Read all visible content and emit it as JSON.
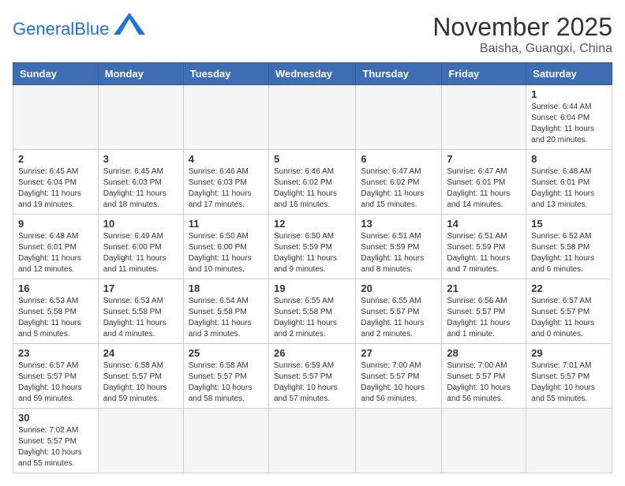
{
  "header": {
    "logo_general": "General",
    "logo_blue": "Blue",
    "month_title": "November 2025",
    "location": "Baisha, Guangxi, China"
  },
  "days_of_week": [
    "Sunday",
    "Monday",
    "Tuesday",
    "Wednesday",
    "Thursday",
    "Friday",
    "Saturday"
  ],
  "weeks": [
    [
      {
        "day": "",
        "info": ""
      },
      {
        "day": "",
        "info": ""
      },
      {
        "day": "",
        "info": ""
      },
      {
        "day": "",
        "info": ""
      },
      {
        "day": "",
        "info": ""
      },
      {
        "day": "",
        "info": ""
      },
      {
        "day": "1",
        "info": "Sunrise: 6:44 AM\nSunset: 6:04 PM\nDaylight: 11 hours and 20 minutes."
      }
    ],
    [
      {
        "day": "2",
        "info": "Sunrise: 6:45 AM\nSunset: 6:04 PM\nDaylight: 11 hours and 19 minutes."
      },
      {
        "day": "3",
        "info": "Sunrise: 6:45 AM\nSunset: 6:03 PM\nDaylight: 11 hours and 18 minutes."
      },
      {
        "day": "4",
        "info": "Sunrise: 6:46 AM\nSunset: 6:03 PM\nDaylight: 11 hours and 17 minutes."
      },
      {
        "day": "5",
        "info": "Sunrise: 6:46 AM\nSunset: 6:02 PM\nDaylight: 11 hours and 16 minutes."
      },
      {
        "day": "6",
        "info": "Sunrise: 6:47 AM\nSunset: 6:02 PM\nDaylight: 11 hours and 15 minutes."
      },
      {
        "day": "7",
        "info": "Sunrise: 6:47 AM\nSunset: 6:01 PM\nDaylight: 11 hours and 14 minutes."
      },
      {
        "day": "8",
        "info": "Sunrise: 6:48 AM\nSunset: 6:01 PM\nDaylight: 11 hours and 13 minutes."
      }
    ],
    [
      {
        "day": "9",
        "info": "Sunrise: 6:48 AM\nSunset: 6:01 PM\nDaylight: 11 hours and 12 minutes."
      },
      {
        "day": "10",
        "info": "Sunrise: 6:49 AM\nSunset: 6:00 PM\nDaylight: 11 hours and 11 minutes."
      },
      {
        "day": "11",
        "info": "Sunrise: 6:50 AM\nSunset: 6:00 PM\nDaylight: 11 hours and 10 minutes."
      },
      {
        "day": "12",
        "info": "Sunrise: 6:50 AM\nSunset: 5:59 PM\nDaylight: 11 hours and 9 minutes."
      },
      {
        "day": "13",
        "info": "Sunrise: 6:51 AM\nSunset: 5:59 PM\nDaylight: 11 hours and 8 minutes."
      },
      {
        "day": "14",
        "info": "Sunrise: 6:51 AM\nSunset: 5:59 PM\nDaylight: 11 hours and 7 minutes."
      },
      {
        "day": "15",
        "info": "Sunrise: 6:52 AM\nSunset: 5:58 PM\nDaylight: 11 hours and 6 minutes."
      }
    ],
    [
      {
        "day": "16",
        "info": "Sunrise: 6:53 AM\nSunset: 5:58 PM\nDaylight: 11 hours and 5 minutes."
      },
      {
        "day": "17",
        "info": "Sunrise: 6:53 AM\nSunset: 5:58 PM\nDaylight: 11 hours and 4 minutes."
      },
      {
        "day": "18",
        "info": "Sunrise: 6:54 AM\nSunset: 5:58 PM\nDaylight: 11 hours and 3 minutes."
      },
      {
        "day": "19",
        "info": "Sunrise: 6:55 AM\nSunset: 5:58 PM\nDaylight: 11 hours and 2 minutes."
      },
      {
        "day": "20",
        "info": "Sunrise: 6:55 AM\nSunset: 5:57 PM\nDaylight: 11 hours and 2 minutes."
      },
      {
        "day": "21",
        "info": "Sunrise: 6:56 AM\nSunset: 5:57 PM\nDaylight: 11 hours and 1 minute."
      },
      {
        "day": "22",
        "info": "Sunrise: 6:57 AM\nSunset: 5:57 PM\nDaylight: 11 hours and 0 minutes."
      }
    ],
    [
      {
        "day": "23",
        "info": "Sunrise: 6:57 AM\nSunset: 5:57 PM\nDaylight: 10 hours and 59 minutes."
      },
      {
        "day": "24",
        "info": "Sunrise: 6:58 AM\nSunset: 5:57 PM\nDaylight: 10 hours and 59 minutes."
      },
      {
        "day": "25",
        "info": "Sunrise: 6:58 AM\nSunset: 5:57 PM\nDaylight: 10 hours and 58 minutes."
      },
      {
        "day": "26",
        "info": "Sunrise: 6:59 AM\nSunset: 5:57 PM\nDaylight: 10 hours and 57 minutes."
      },
      {
        "day": "27",
        "info": "Sunrise: 7:00 AM\nSunset: 5:57 PM\nDaylight: 10 hours and 56 minutes."
      },
      {
        "day": "28",
        "info": "Sunrise: 7:00 AM\nSunset: 5:57 PM\nDaylight: 10 hours and 56 minutes."
      },
      {
        "day": "29",
        "info": "Sunrise: 7:01 AM\nSunset: 5:57 PM\nDaylight: 10 hours and 55 minutes."
      }
    ],
    [
      {
        "day": "30",
        "info": "Sunrise: 7:02 AM\nSunset: 5:57 PM\nDaylight: 10 hours and 55 minutes."
      },
      {
        "day": "",
        "info": ""
      },
      {
        "day": "",
        "info": ""
      },
      {
        "day": "",
        "info": ""
      },
      {
        "day": "",
        "info": ""
      },
      {
        "day": "",
        "info": ""
      },
      {
        "day": "",
        "info": ""
      }
    ]
  ]
}
